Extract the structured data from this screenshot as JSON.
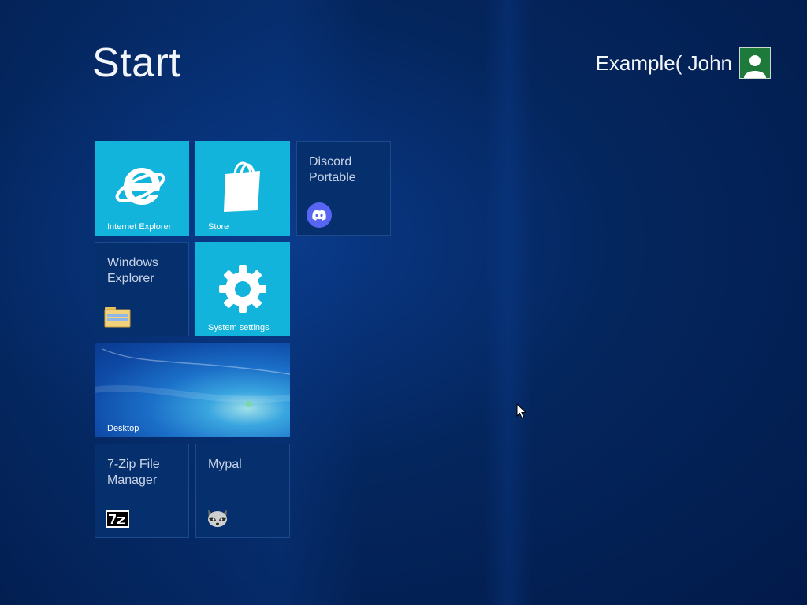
{
  "header": {
    "title": "Start",
    "user_name": "Example( John"
  },
  "tiles": {
    "ie": {
      "label": "Internet Explorer",
      "icon": "internet-explorer-icon"
    },
    "store": {
      "label": "Store",
      "icon": "shopping-bag-icon"
    },
    "discord": {
      "label": "Discord\nPortable",
      "icon": "discord-icon"
    },
    "explorer": {
      "label": "Windows\nExplorer",
      "icon": "folder-icon"
    },
    "settings": {
      "label": "System settings",
      "icon": "gear-icon"
    },
    "desktop": {
      "label": "Desktop"
    },
    "sevenzip": {
      "label": "7-Zip File\nManager",
      "icon": "7zip-icon"
    },
    "mypal": {
      "label": "Mypal",
      "icon": "raccoon-icon"
    }
  },
  "colors": {
    "accent_cyan": "#13b4dc",
    "dark_tile": "#062f6e",
    "background": "#03205a"
  }
}
